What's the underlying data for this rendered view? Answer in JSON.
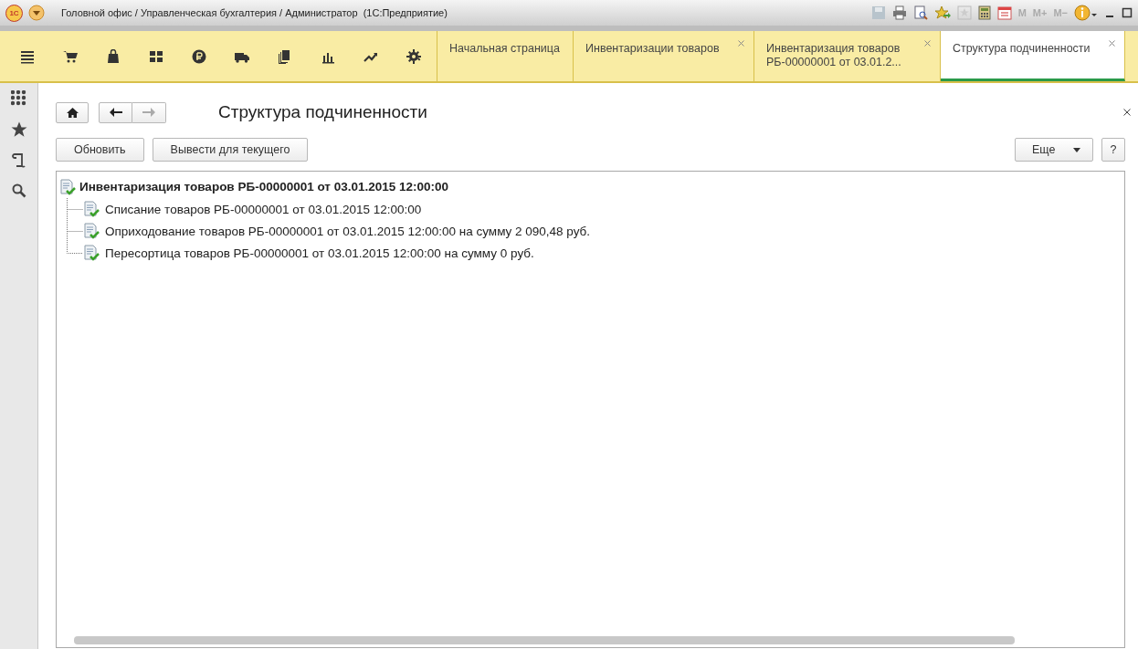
{
  "window": {
    "title": "Головной офис / Управленческая бухгалтерия / Администратор  (1С:Предприятие)",
    "logo": "1С",
    "memory_buttons": [
      "M",
      "M+",
      "M−"
    ]
  },
  "tabs": [
    {
      "label": "Начальная страница",
      "selected": false,
      "closable": false
    },
    {
      "label": "Инвентаризации товаров",
      "selected": false,
      "closable": true
    },
    {
      "label": "Инвентаризация товаров\nРБ-00000001 от 03.01.2...",
      "selected": false,
      "closable": true
    },
    {
      "label": "Структура подчиненности",
      "selected": true,
      "closable": true
    }
  ],
  "form": {
    "title": "Структура подчиненности",
    "buttons": [
      "Обновить",
      "Вывести для текущего"
    ],
    "more_button": "Еще",
    "help_button": "?"
  },
  "tree": [
    {
      "label": "Инвентаризация товаров РБ-00000001 от 03.01.2015 12:00:00",
      "children": [
        {
          "label": "Списание товаров РБ-00000001 от 03.01.2015 12:00:00"
        },
        {
          "label": "Оприходование товаров РБ-00000001 от 03.01.2015 12:00:00 на сумму 2 090,48 руб."
        },
        {
          "label": "Пересортица товаров РБ-00000001 от 03.01.2015 12:00:00 на сумму 0 руб."
        }
      ]
    }
  ]
}
